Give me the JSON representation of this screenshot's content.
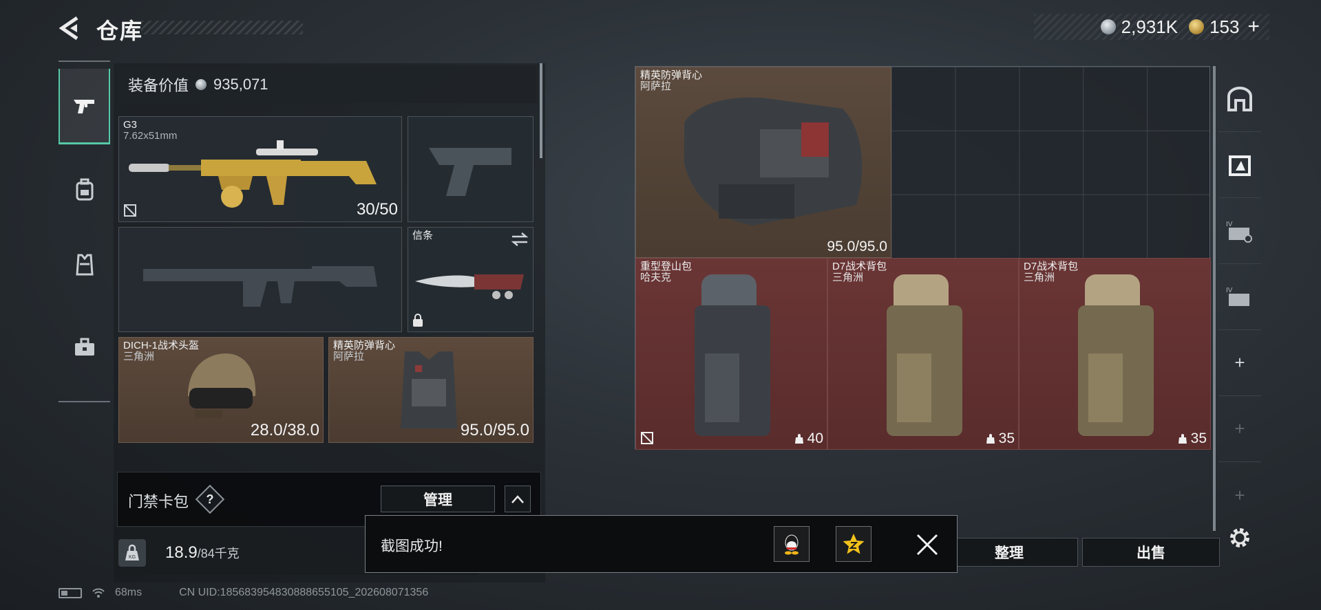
{
  "header": {
    "title": "仓库",
    "currency_silver": "2,931K",
    "currency_gold": "153"
  },
  "left_nav": {
    "items": [
      {
        "icon": "pistol-icon",
        "active": true
      },
      {
        "icon": "backpack-icon",
        "active": false
      },
      {
        "icon": "vest-icon",
        "active": false
      },
      {
        "icon": "toolbox-icon",
        "active": false
      }
    ]
  },
  "equipment": {
    "value_label": "装备价值",
    "value": "935,071",
    "primary_weapon": {
      "name": "G3",
      "caliber": "7.62x51mm",
      "ammo": "30/50"
    },
    "melee": {
      "name": "信条"
    },
    "helmet": {
      "name": "DICH-1战术头盔",
      "origin": "三角洲",
      "durability": "28.0/38.0"
    },
    "armor": {
      "name": "精英防弹背心",
      "origin": "阿萨拉",
      "durability": "95.0/95.0"
    }
  },
  "access_card": {
    "label": "门禁卡包",
    "help": "?",
    "manage_label": "管理"
  },
  "weight": {
    "current": "18.9",
    "max": "/84千克",
    "kg_icon_text": "KG"
  },
  "storage": {
    "vest": {
      "name": "精英防弹背心",
      "origin": "阿萨拉",
      "durability": "95.0/95.0"
    },
    "bags": [
      {
        "name": "重型登山包",
        "origin": "哈夫克",
        "capacity": "40"
      },
      {
        "name": "D7战术背包",
        "origin": "三角洲",
        "capacity": "35"
      },
      {
        "name": "D7战术背包",
        "origin": "三角洲",
        "capacity": "35"
      }
    ]
  },
  "buttons": {
    "sort": "整理",
    "sell": "出售"
  },
  "toast": {
    "message": "截图成功!"
  },
  "status": {
    "ping": "68ms",
    "uid": "CN UID:18568395483088865510​5_202608071356"
  },
  "colors": {
    "accent_green": "#56c9a6",
    "bag_red": "#6a3535",
    "armor_brown": "#5b4a3d"
  }
}
